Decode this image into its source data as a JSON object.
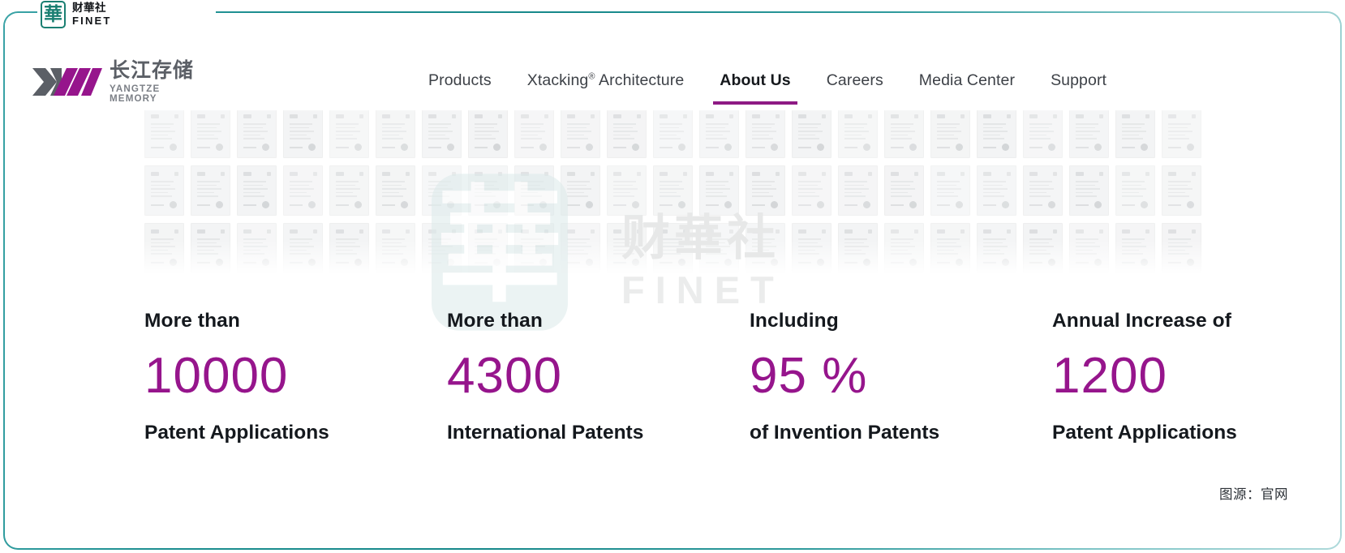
{
  "frame": {
    "border_color": "#1c8e90"
  },
  "finet_badge": {
    "seal_glyph": "華",
    "cn_name": "财華社",
    "en_name": "FINET"
  },
  "header": {
    "logo": {
      "cn": "长江存储",
      "en": "YANGTZE MEMORY",
      "mark_colors": [
        "#5b5f66",
        "#96158c"
      ]
    },
    "nav": [
      {
        "label": "Products",
        "active": false,
        "sup": ""
      },
      {
        "label": "Xtacking",
        "active": false,
        "sup": "®",
        "suffix": " Architecture"
      },
      {
        "label": "About Us",
        "active": true,
        "sup": ""
      },
      {
        "label": "Careers",
        "active": false,
        "sup": ""
      },
      {
        "label": "Media Center",
        "active": false,
        "sup": ""
      },
      {
        "label": "Support",
        "active": false,
        "sup": ""
      }
    ],
    "active_underline_color": "#8e1a84"
  },
  "cert_wall": {
    "columns": 23,
    "rows": 3,
    "description": "grid of faded patent certificate thumbnails"
  },
  "watermark": {
    "seal_glyph": "華",
    "cn": "财華社",
    "en": "FINET"
  },
  "stats": {
    "accent_color": "#96158c",
    "items": [
      {
        "prefix": "More than",
        "value": "10000",
        "label": "Patent Applications"
      },
      {
        "prefix": "More than",
        "value": "4300",
        "label": "International Patents"
      },
      {
        "prefix": "Including",
        "value": "95 %",
        "label": "of Invention Patents"
      },
      {
        "prefix": "Annual Increase of",
        "value": "1200",
        "label": "Patent Applications"
      }
    ]
  },
  "source_credit": "图源：官网",
  "chart_data": {
    "type": "bar",
    "title": "Yangtze Memory Patent Portfolio",
    "categories": [
      "Patent Applications",
      "International Patents",
      "of Invention Patents",
      "Patent Applications (Annual Increase)"
    ],
    "values": [
      10000,
      4300,
      95,
      1200
    ],
    "value_labels": [
      "10000",
      "4300",
      "95 %",
      "1200"
    ],
    "prefixes": [
      "More than",
      "More than",
      "Including",
      "Annual Increase of"
    ],
    "xlabel": "",
    "ylabel": "",
    "legend": "none"
  }
}
